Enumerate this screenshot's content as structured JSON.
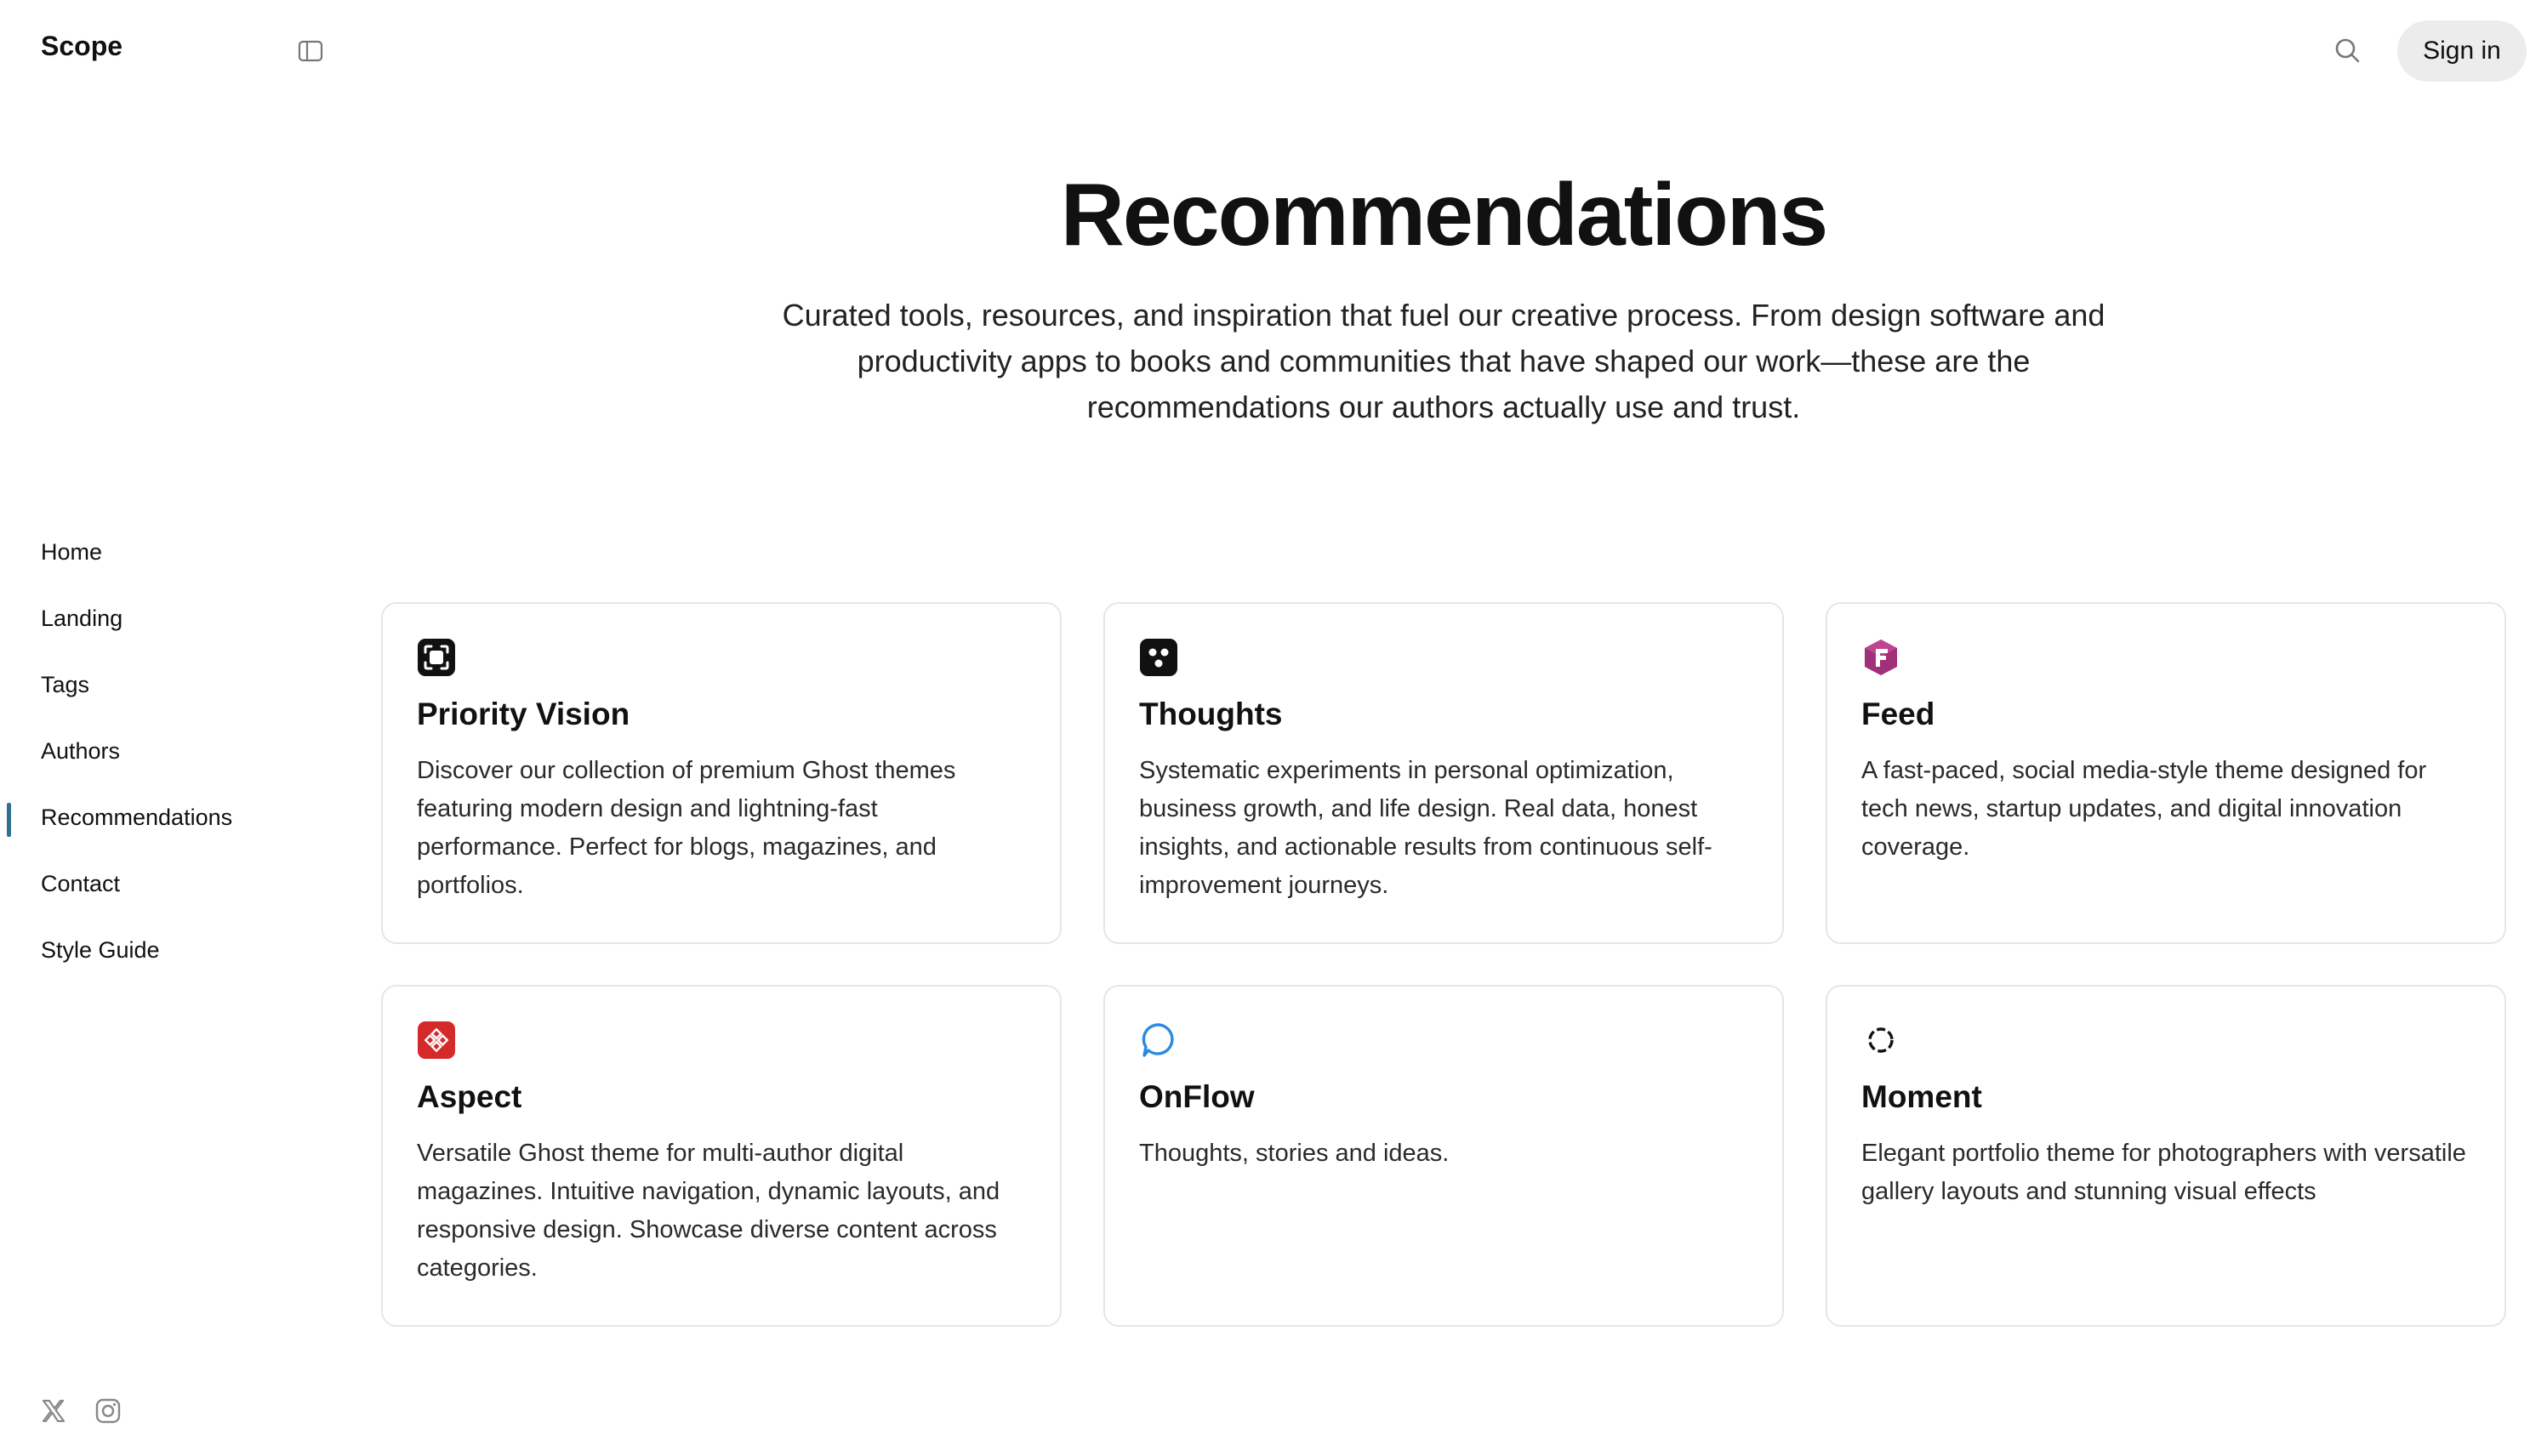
{
  "header": {
    "brand": "Scope",
    "sign_in_label": "Sign in"
  },
  "icons": {
    "sidebar_toggle": "sidebar-toggle-icon",
    "search": "search-icon",
    "x": "x-icon",
    "instagram": "instagram-icon"
  },
  "sidebar": {
    "items": [
      {
        "label": "Home",
        "active": false
      },
      {
        "label": "Landing",
        "active": false
      },
      {
        "label": "Tags",
        "active": false
      },
      {
        "label": "Authors",
        "active": false
      },
      {
        "label": "Recommendations",
        "active": true
      },
      {
        "label": "Contact",
        "active": false
      },
      {
        "label": "Style Guide",
        "active": false
      }
    ]
  },
  "hero": {
    "title": "Recommendations",
    "subtitle": "Curated tools, resources, and inspiration that fuel our creative process. From design software and productivity apps to books and communities that have shaped our work—these are the recommendations our authors actually use and trust."
  },
  "cards": [
    {
      "title": "Priority Vision",
      "description": "Discover our collection of premium Ghost themes featuring modern design and lightning-fast performance. Perfect for blogs, magazines, and portfolios.",
      "icon": "priority-vision-logo-icon"
    },
    {
      "title": "Thoughts",
      "description": "Systematic experiments in personal optimization, business growth, and life design. Real data, honest insights, and actionable results from continuous self-improvement journeys.",
      "icon": "thoughts-logo-icon"
    },
    {
      "title": "Feed",
      "description": "A fast-paced, social media-style theme designed for tech news, startup updates, and digital innovation coverage.",
      "icon": "feed-logo-icon"
    },
    {
      "title": "Aspect",
      "description": "Versatile Ghost theme for multi-author digital magazines. Intuitive navigation, dynamic layouts, and responsive design. Showcase diverse content across categories.",
      "icon": "aspect-logo-icon"
    },
    {
      "title": "OnFlow",
      "description": "Thoughts, stories and ideas.",
      "icon": "onflow-logo-icon"
    },
    {
      "title": "Moment",
      "description": "Elegant portfolio theme for photographers with versatile gallery layouts and stunning visual effects",
      "icon": "moment-logo-icon"
    }
  ],
  "colors": {
    "active_indicator": "#2f6f8f",
    "feed_logo": "#a0307a",
    "aspect_logo": "#d42a2a",
    "onflow_logo": "#2a8ae0"
  }
}
